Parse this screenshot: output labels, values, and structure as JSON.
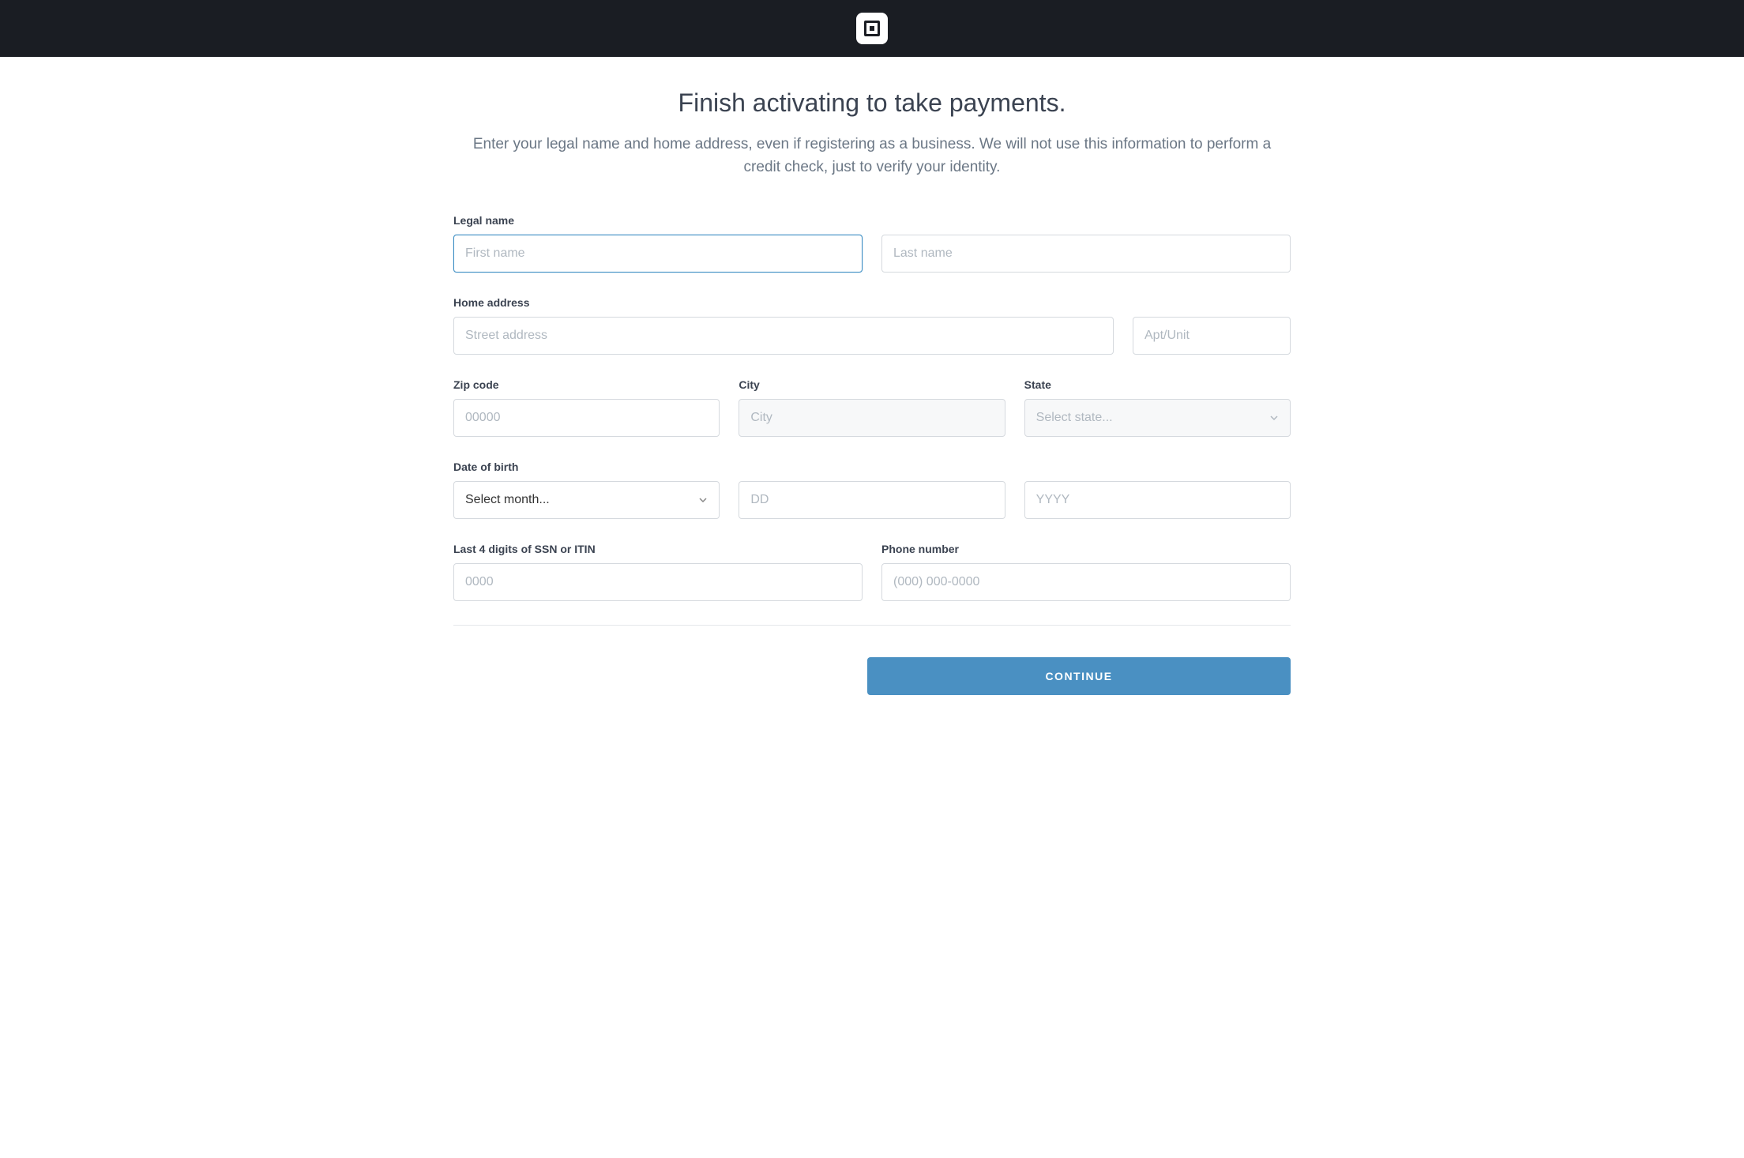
{
  "header": {
    "logo_name": "square-logo"
  },
  "page": {
    "title": "Finish activating to take payments.",
    "subtitle": "Enter your legal name and home address, even if registering as a business. We will not use this information to perform a credit check, just to verify your identity."
  },
  "form": {
    "legal_name": {
      "label": "Legal name",
      "first_placeholder": "First name",
      "first_value": "",
      "last_placeholder": "Last name",
      "last_value": ""
    },
    "home_address": {
      "label": "Home address",
      "street_placeholder": "Street address",
      "street_value": "",
      "apt_placeholder": "Apt/Unit",
      "apt_value": ""
    },
    "zip": {
      "label": "Zip code",
      "placeholder": "00000",
      "value": ""
    },
    "city": {
      "label": "City",
      "placeholder": "City",
      "value": ""
    },
    "state": {
      "label": "State",
      "placeholder": "Select state...",
      "value": ""
    },
    "dob": {
      "label": "Date of birth",
      "month_placeholder": "Select month...",
      "month_value": "",
      "day_placeholder": "DD",
      "day_value": "",
      "year_placeholder": "YYYY",
      "year_value": ""
    },
    "ssn": {
      "label": "Last 4 digits of SSN or ITIN",
      "placeholder": "0000",
      "value": ""
    },
    "phone": {
      "label": "Phone number",
      "placeholder": "(000) 000-0000",
      "value": ""
    }
  },
  "actions": {
    "continue_label": "CONTINUE"
  }
}
